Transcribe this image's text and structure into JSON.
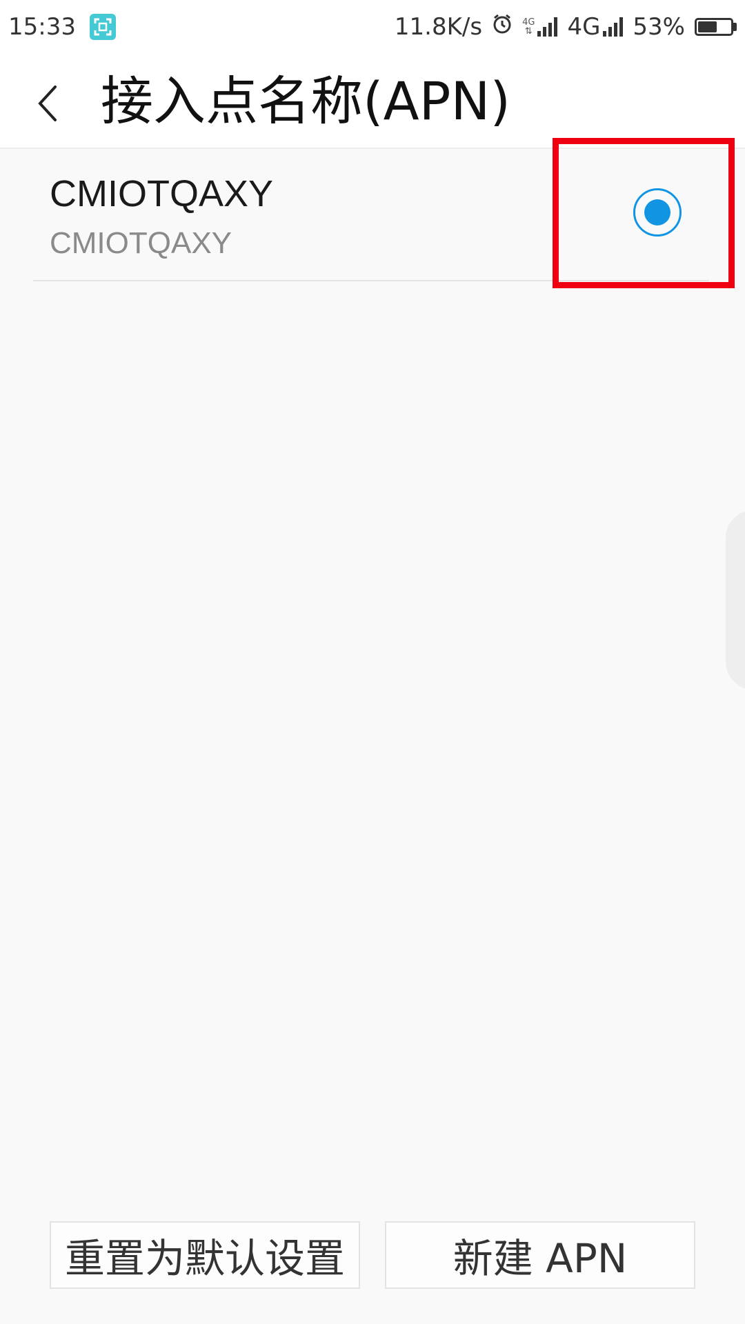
{
  "status_bar": {
    "time": "15:33",
    "net_speed": "11.8K/s",
    "sim1_label": "4G",
    "sim2_label": "4G",
    "battery_percent": "53%",
    "battery_level": 0.53,
    "icons": [
      "screenshot-icon",
      "alarm-icon",
      "signal-icon",
      "signal-icon",
      "battery-icon"
    ]
  },
  "header": {
    "title": "接入点名称(APN)",
    "back_icon": "chevron-left-icon"
  },
  "apn_list": [
    {
      "name": "CMIOTQAXY",
      "apn": "CMIOTQAXY",
      "selected": true
    }
  ],
  "buttons": {
    "reset_label": "重置为默认设置",
    "new_apn_label": "新建 APN"
  },
  "colors": {
    "accent": "#1195e3",
    "highlight": "#ee0010",
    "screenshot_badge": "#45c9d4"
  }
}
